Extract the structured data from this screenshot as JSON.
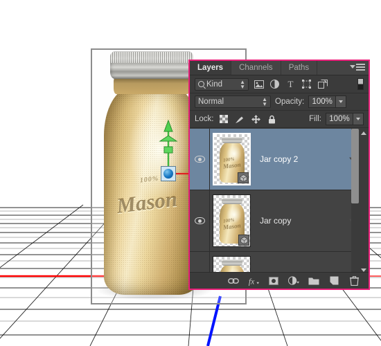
{
  "app": {
    "panel_accent_color": "#ea1e79",
    "panel_bg_color": "#3b3b3b",
    "selection_color": "#6d86a0"
  },
  "canvas": {
    "object_name": "mason-jar",
    "jar_emboss_small": "100%",
    "jar_emboss_main": "Mason",
    "grid_color": "#000000",
    "x_axis_color": "#ff0000",
    "z_axis_color": "#0000ff",
    "y_axis_color": "#4cc94c"
  },
  "panel": {
    "tabs": [
      {
        "label": "Layers",
        "active": true
      },
      {
        "label": "Channels",
        "active": false
      },
      {
        "label": "Paths",
        "active": false
      }
    ],
    "menu_label": "Panel Menu",
    "filter_row": {
      "kind_label": "Kind",
      "icons": [
        "pixel-layer-filter-icon",
        "adjustment-layer-filter-icon",
        "type-layer-filter-icon",
        "shape-layer-filter-icon",
        "smart-object-filter-icon"
      ],
      "toggle_label": "Filter Toggle"
    },
    "blend_row": {
      "blend_mode": "Normal",
      "opacity_label": "Opacity:",
      "opacity_value": "100%"
    },
    "lock_row": {
      "lock_label": "Lock:",
      "lock_icons": [
        "lock-transparent-pixels-icon",
        "lock-image-pixels-icon",
        "lock-position-icon",
        "lock-all-icon"
      ],
      "fill_label": "Fill:",
      "fill_value": "100%"
    },
    "layers": [
      {
        "name": "Jar copy 2",
        "visible": true,
        "selected": true,
        "has_3d_badge": true,
        "thumb_emboss_small": "100%",
        "thumb_emboss_main": "Mason"
      },
      {
        "name": "Jar copy",
        "visible": true,
        "selected": false,
        "has_3d_badge": true,
        "thumb_emboss_small": "100%",
        "thumb_emboss_main": "Mason"
      },
      {
        "name": "",
        "visible": false,
        "selected": false,
        "has_3d_badge": false,
        "thumb_emboss_small": "",
        "thumb_emboss_main": ""
      }
    ],
    "footer_icons": [
      "link-layers-icon",
      "layer-style-fx-icon",
      "add-layer-mask-icon",
      "new-adjustment-layer-icon",
      "new-group-icon",
      "new-layer-icon",
      "delete-layer-icon"
    ]
  }
}
